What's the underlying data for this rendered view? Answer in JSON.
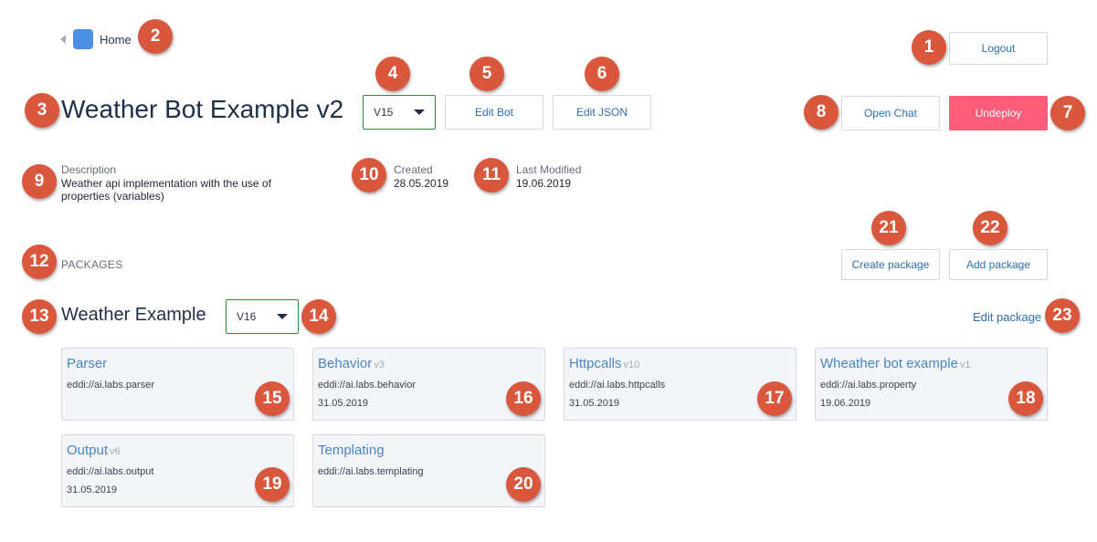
{
  "nav": {
    "home_label": "Home"
  },
  "header": {
    "logout_label": "Logout",
    "bot_title": "Weather Bot Example v2",
    "version_selected": "V15",
    "edit_bot_label": "Edit Bot",
    "edit_json_label": "Edit JSON",
    "open_chat_label": "Open Chat",
    "undeploy_label": "Undeploy"
  },
  "info": {
    "description_label": "Description",
    "description_line1": "Weather api implementation with the use of",
    "description_line2": "properties (variables)",
    "created_label": "Created",
    "created_value": "28.05.2019",
    "modified_label": "Last Modified",
    "modified_value": "19.06.2019"
  },
  "packages": {
    "section_label": "PACKAGES",
    "create_label": "Create package",
    "add_label": "Add package",
    "package_name": "Weather Example",
    "package_version": "V16",
    "edit_label": "Edit package",
    "cards": [
      {
        "title": "Parser",
        "version": "",
        "uri": "eddi://ai.labs.parser",
        "date": ""
      },
      {
        "title": "Behavior",
        "version": "v3",
        "uri": "eddi://ai.labs.behavior",
        "date": "31.05.2019"
      },
      {
        "title": "Httpcalls",
        "version": "v10",
        "uri": "eddi://ai.labs.httpcalls",
        "date": "31.05.2019"
      },
      {
        "title": "Wheather bot example",
        "version": "v1",
        "uri": "eddi://ai.labs.property",
        "date": "19.06.2019"
      },
      {
        "title": "Output",
        "version": "v6",
        "uri": "eddi://ai.labs.output",
        "date": "31.05.2019"
      },
      {
        "title": "Templating",
        "version": "",
        "uri": "eddi://ai.labs.templating",
        "date": ""
      }
    ]
  },
  "callouts": [
    "1",
    "2",
    "3",
    "4",
    "5",
    "6",
    "7",
    "8",
    "9",
    "10",
    "11",
    "12",
    "13",
    "14",
    "15",
    "16",
    "17",
    "18",
    "19",
    "20",
    "21",
    "22",
    "23"
  ],
  "colors": {
    "callout": "#d9573d",
    "link": "#2f6fb0",
    "danger": "#ff5c7a",
    "select_border": "#2e8b3c",
    "home_icon": "#4a8fe2"
  }
}
